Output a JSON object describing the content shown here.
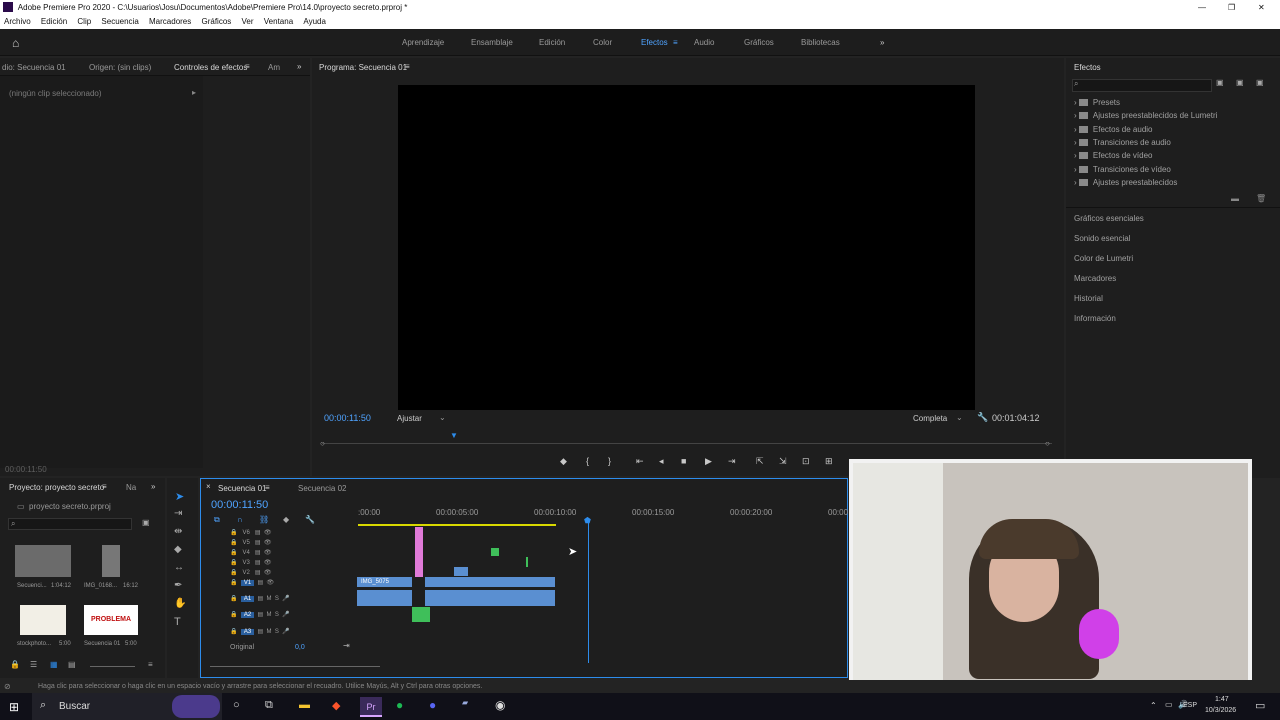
{
  "window": {
    "title": "Adobe Premiere Pro 2020 - C:\\Usuarios\\Josu\\Documentos\\Adobe\\Premiere Pro\\14.0\\proyecto secreto.prproj *",
    "controls": [
      "—",
      "❐",
      "✕"
    ]
  },
  "menu": [
    "Archivo",
    "Edición",
    "Clip",
    "Secuencia",
    "Marcadores",
    "Gráficos",
    "Ver",
    "Ventana",
    "Ayuda"
  ],
  "workspaces": [
    "Aprendizaje",
    "Ensamblaje",
    "Edición",
    "Color",
    "Efectos",
    "Audio",
    "Gráficos",
    "Bibliotecas"
  ],
  "active_workspace": "Efectos",
  "left_panel": {
    "tabs": [
      "dio: Secuencia 01",
      "Origen: (sin clips)",
      "Controles de efectos",
      "Am"
    ],
    "message": "(ningún clip seleccionado)",
    "timecode": "00:00:11:50"
  },
  "program": {
    "title": "Programa: Secuencia 01",
    "timecode": "00:00:11:50",
    "fit": "Ajustar",
    "quality": "Completa",
    "duration": "00:01:04:12"
  },
  "effects": {
    "title": "Efectos",
    "items": [
      "Presets",
      "Ajustes preestablecidos de Lumetri",
      "Efectos de audio",
      "Transiciones de audio",
      "Efectos de vídeo",
      "Transiciones de vídeo",
      "Ajustes preestablecidos"
    ],
    "panels": [
      "Gráficos esenciales",
      "Sonido esencial",
      "Color de Lumetri",
      "Marcadores",
      "Historial",
      "Información"
    ]
  },
  "project": {
    "tabs": [
      "Proyecto: proyecto secreto",
      "Na"
    ],
    "file": "proyecto secreto.prproj",
    "items": [
      {
        "name": "Secuenci...",
        "dur": "1:04:12"
      },
      {
        "name": "IMG_0168...",
        "dur": "16:12"
      },
      {
        "name": "stockphoto...",
        "dur": "5:00"
      },
      {
        "name": "Secuencia 01",
        "dur": "5:00"
      }
    ],
    "thumb_text": "PROBLEMA"
  },
  "timeline": {
    "tabs": [
      "Secuencia 01",
      "Secuencia 02"
    ],
    "timecode": "00:00:11:50",
    "ruler": [
      ":00:00",
      "00:00:05:00",
      "00:00:10:00",
      "00:00:15:00",
      "00:00:20:00",
      "00:00"
    ],
    "video_tracks": [
      "V6",
      "V5",
      "V4",
      "V3",
      "V2",
      "V1"
    ],
    "audio_tracks": [
      "A1",
      "A2",
      "A3"
    ],
    "clip_label": "IMG_5075",
    "original_label": "Original",
    "original_value": "0,0"
  },
  "status": "Haga clic para seleccionar o haga clic en un espacio vacío y arrastre para seleccionar el recuadro. Utilice Mayús, Alt y Ctrl para otras opciones.",
  "taskbar": {
    "search": "Buscar",
    "lang": "ESP",
    "time": "1:47",
    "date": "10/3/2026"
  },
  "colors": {
    "accent": "#2d8ceb",
    "timecode": "#4fa3ff",
    "video_clip": "#5a8fd1",
    "pink_clip": "#e07ad8",
    "green_clip": "#3fbf5a"
  }
}
